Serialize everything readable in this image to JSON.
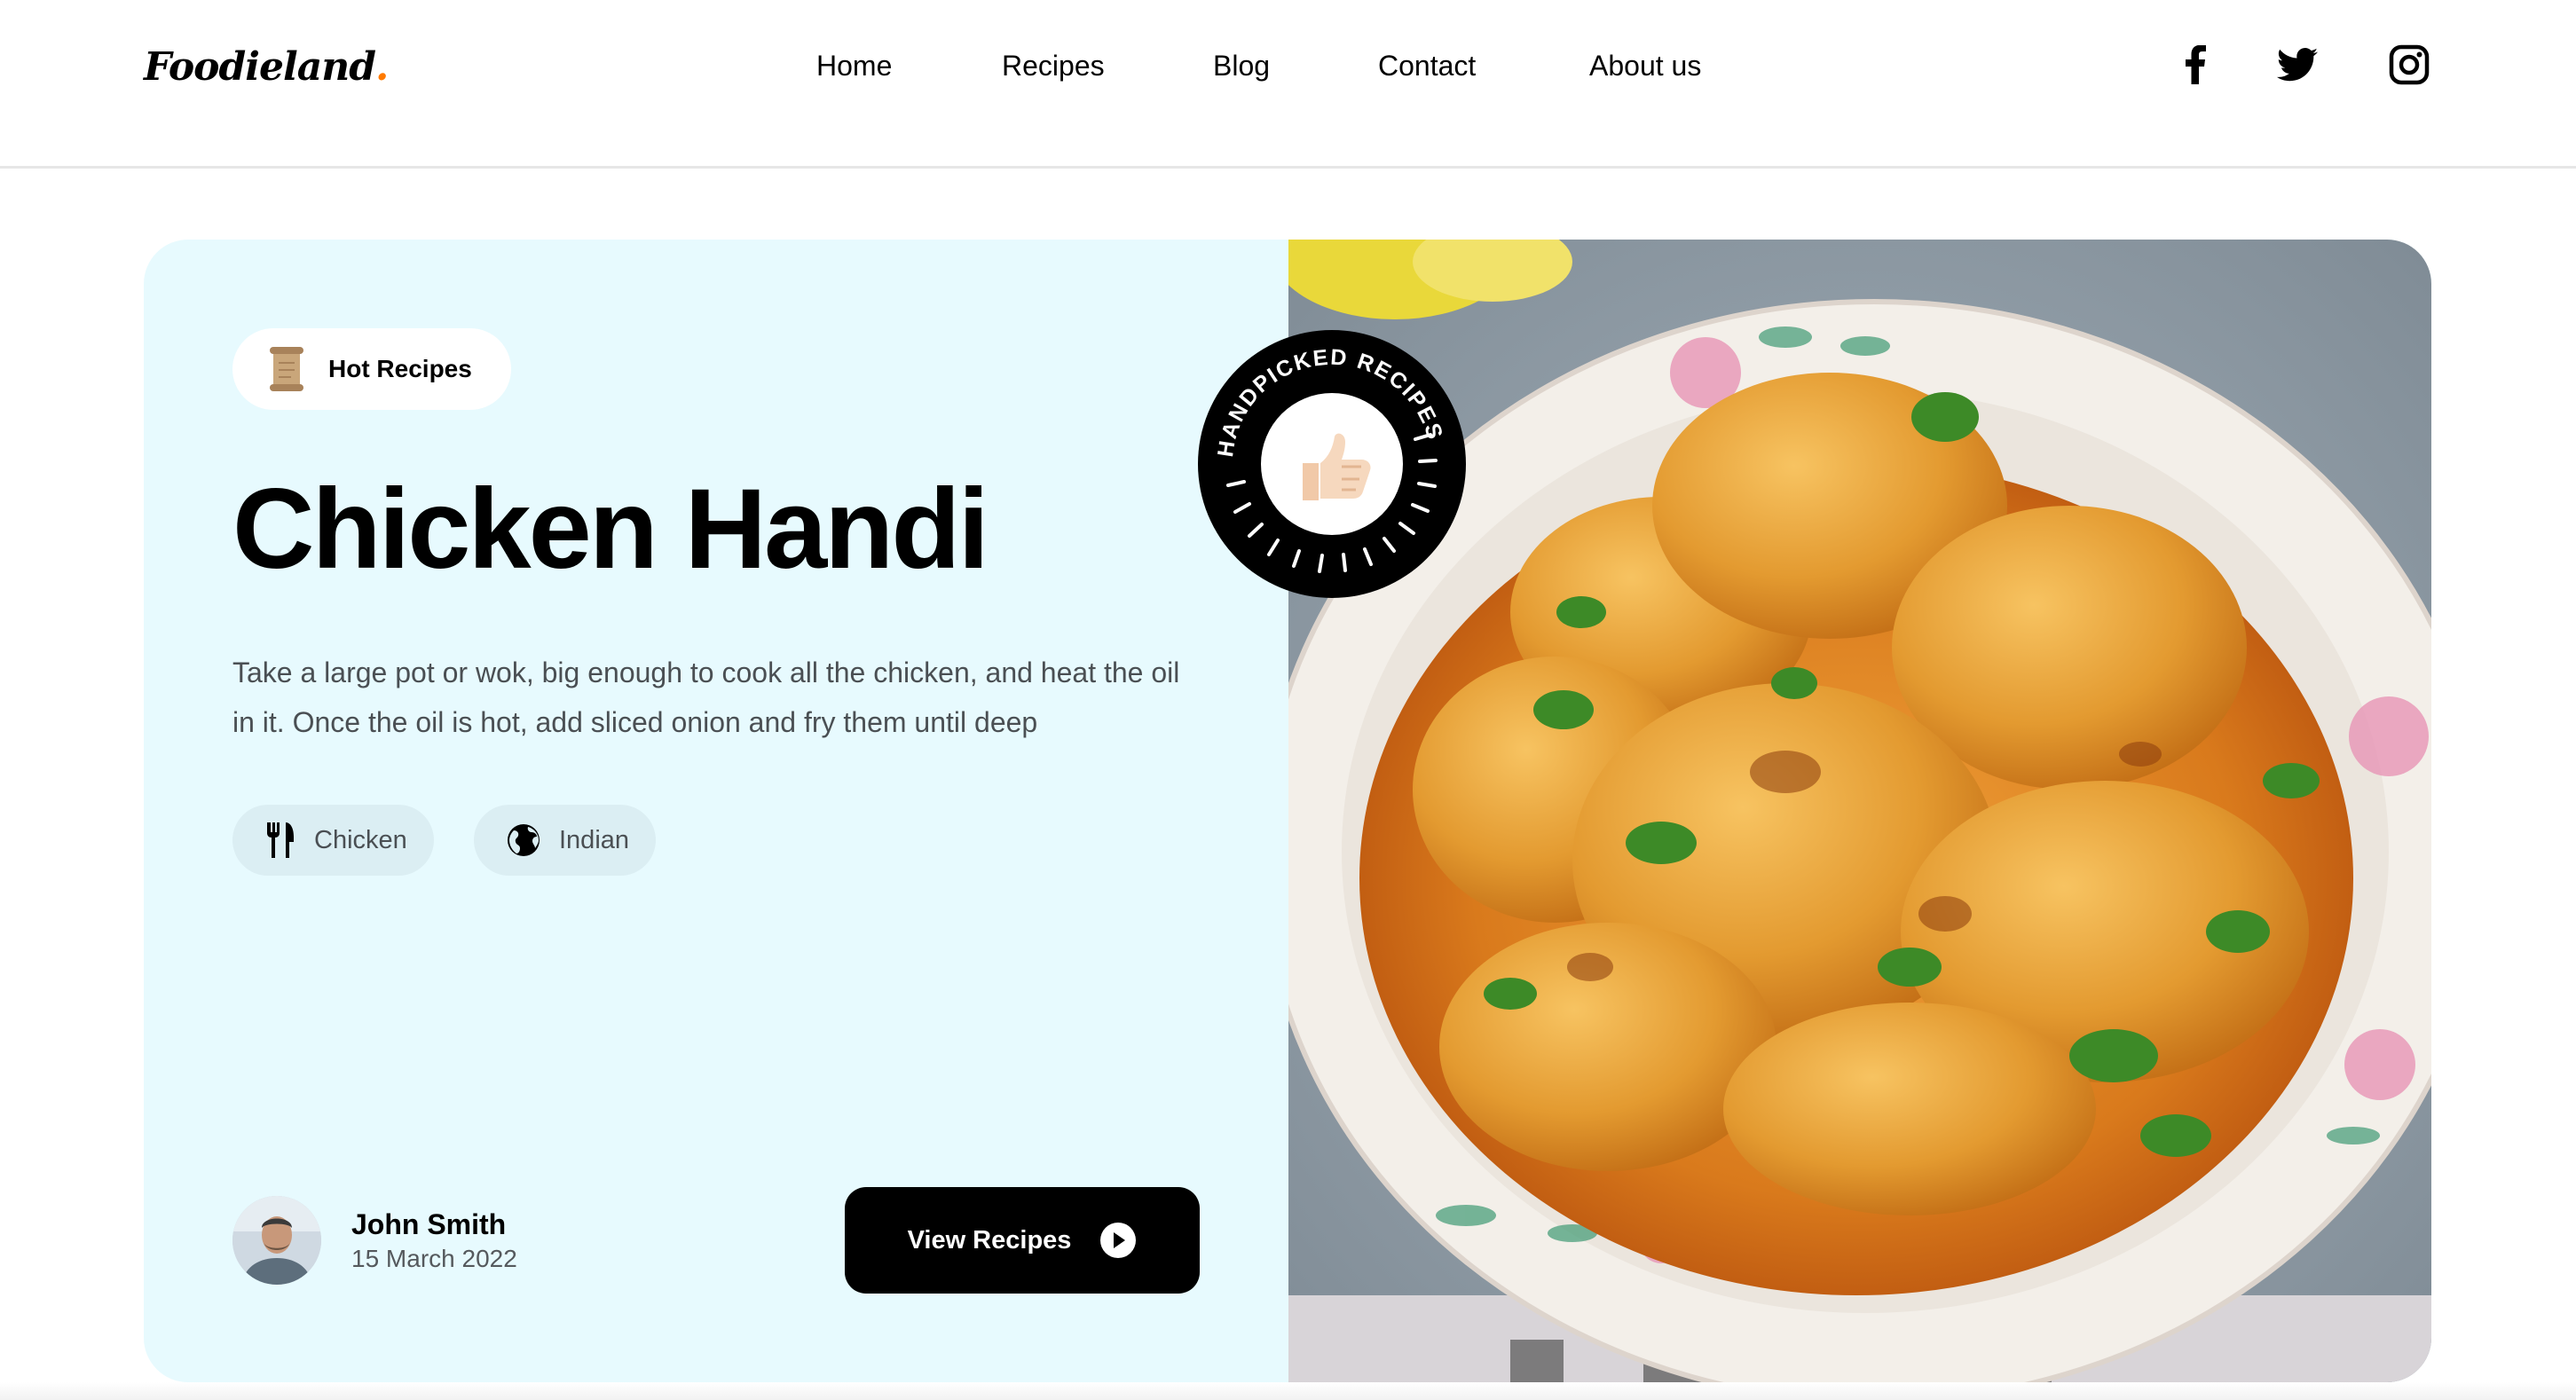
{
  "brand": {
    "name": "Foodieland",
    "dot": "."
  },
  "nav": {
    "items": [
      {
        "label": "Home"
      },
      {
        "label": "Recipes"
      },
      {
        "label": "Blog"
      },
      {
        "label": "Contact"
      },
      {
        "label": "About us"
      }
    ]
  },
  "social": {
    "icons": [
      "facebook-icon",
      "twitter-icon",
      "instagram-icon"
    ]
  },
  "hero": {
    "badge": "Hot Recipes",
    "title": "Chicken Handi",
    "description": "Take a large pot or wok, big enough to cook all the chicken, and heat the oil in it. Once the oil is hot, add sliced onion and fry them until deep",
    "tags": [
      {
        "label": "Chicken",
        "icon": "fork-knife-icon"
      },
      {
        "label": "Indian",
        "icon": "globe-icon"
      }
    ],
    "author": {
      "name": "John Smith",
      "date": "15 March 2022"
    },
    "cta": "View Recipes",
    "stamp_text": "HANDPICKED RECIPES"
  },
  "colors": {
    "hero_bg": "#e7fafe",
    "chip_bg": "#dbeef3",
    "accent": "#ff7a00",
    "button": "#000000"
  }
}
